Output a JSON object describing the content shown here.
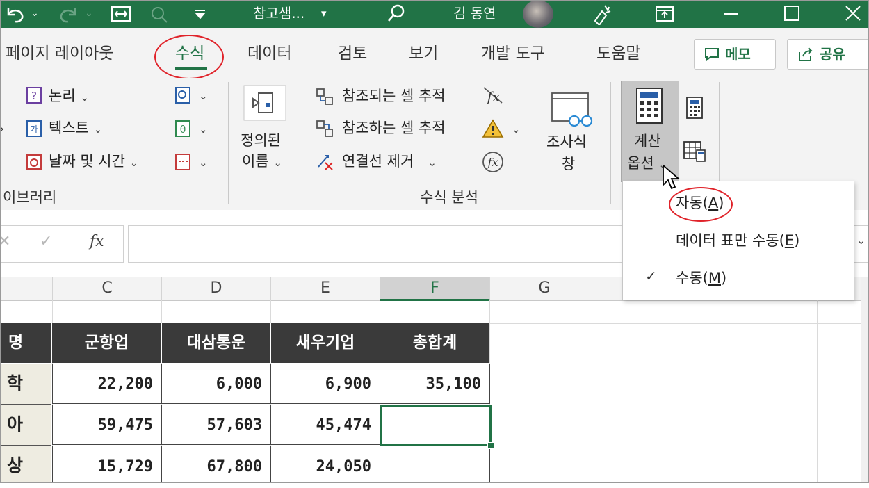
{
  "titlebar": {
    "doc_title": "참고샘...",
    "user_name": "김 동연",
    "undo_icon": "undo-icon",
    "redo_icon": "redo-icon",
    "search_icon": "search-icon"
  },
  "tabs": [
    "페이지 레이아웃",
    "수식",
    "데이터",
    "검토",
    "보기",
    "개발 도구",
    "도움말"
  ],
  "active_tab": "수식",
  "top_buttons": {
    "memo": "메모",
    "share": "공유"
  },
  "ribbon": {
    "library": {
      "logical": "논리",
      "text": "텍스트",
      "datetime": "날짜 및 시간",
      "group_label": "이브러리"
    },
    "defined_names": {
      "line1": "정의된",
      "line2": "이름"
    },
    "audit": {
      "trace_precedents": "참조되는 셀 추적",
      "trace_dependents": "참조하는 셀 추적",
      "remove_arrows": "연결선 제거",
      "group_label": "수식 분석"
    },
    "watch": {
      "line1": "조사식",
      "line2": "창"
    },
    "calc": {
      "line1": "계산",
      "line2": "옵션"
    }
  },
  "formula_bar": {
    "fx_label": "fx",
    "value": ""
  },
  "calc_menu": {
    "items": [
      {
        "label": "자동",
        "key": "A",
        "checked": false
      },
      {
        "label": "데이터 표만 수동",
        "key": "E",
        "checked": false
      },
      {
        "label": "수동",
        "key": "M",
        "checked": true
      }
    ]
  },
  "columns": [
    "C",
    "D",
    "E",
    "F",
    "G"
  ],
  "selected_column": "F",
  "table": {
    "header_first": "명",
    "headers": [
      "군항업",
      "대삼통운",
      "새우기업",
      "총합계"
    ],
    "rows": [
      {
        "label": "학",
        "values": [
          "22,200",
          "6,000",
          "6,900",
          "35,100"
        ]
      },
      {
        "label": "아",
        "values": [
          "59,475",
          "57,603",
          "45,474",
          ""
        ]
      },
      {
        "label": "상",
        "values": [
          "15,729",
          "67,800",
          "24,050",
          ""
        ]
      }
    ]
  },
  "colors": {
    "accent": "#217346",
    "highlight": "#e0232a",
    "header_fill": "#3a3a3a",
    "label_fill": "#eeece1"
  }
}
